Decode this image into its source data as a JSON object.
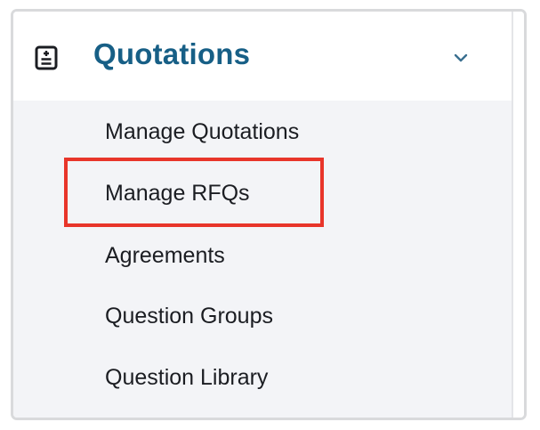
{
  "section": {
    "title": "Quotations",
    "icon": "quotations-list-icon",
    "expand_icon": "chevron-down-icon",
    "expanded": true
  },
  "menu": {
    "items": [
      {
        "label": "Manage Quotations"
      },
      {
        "label": "Manage RFQs",
        "highlighted": true
      },
      {
        "label": "Agreements"
      },
      {
        "label": "Question Groups"
      },
      {
        "label": "Question Library"
      }
    ]
  },
  "colors": {
    "title": "#175f86",
    "menu_text": "#1b1d22",
    "panel_background": "#f3f4f7",
    "highlight": "#e8352a"
  }
}
